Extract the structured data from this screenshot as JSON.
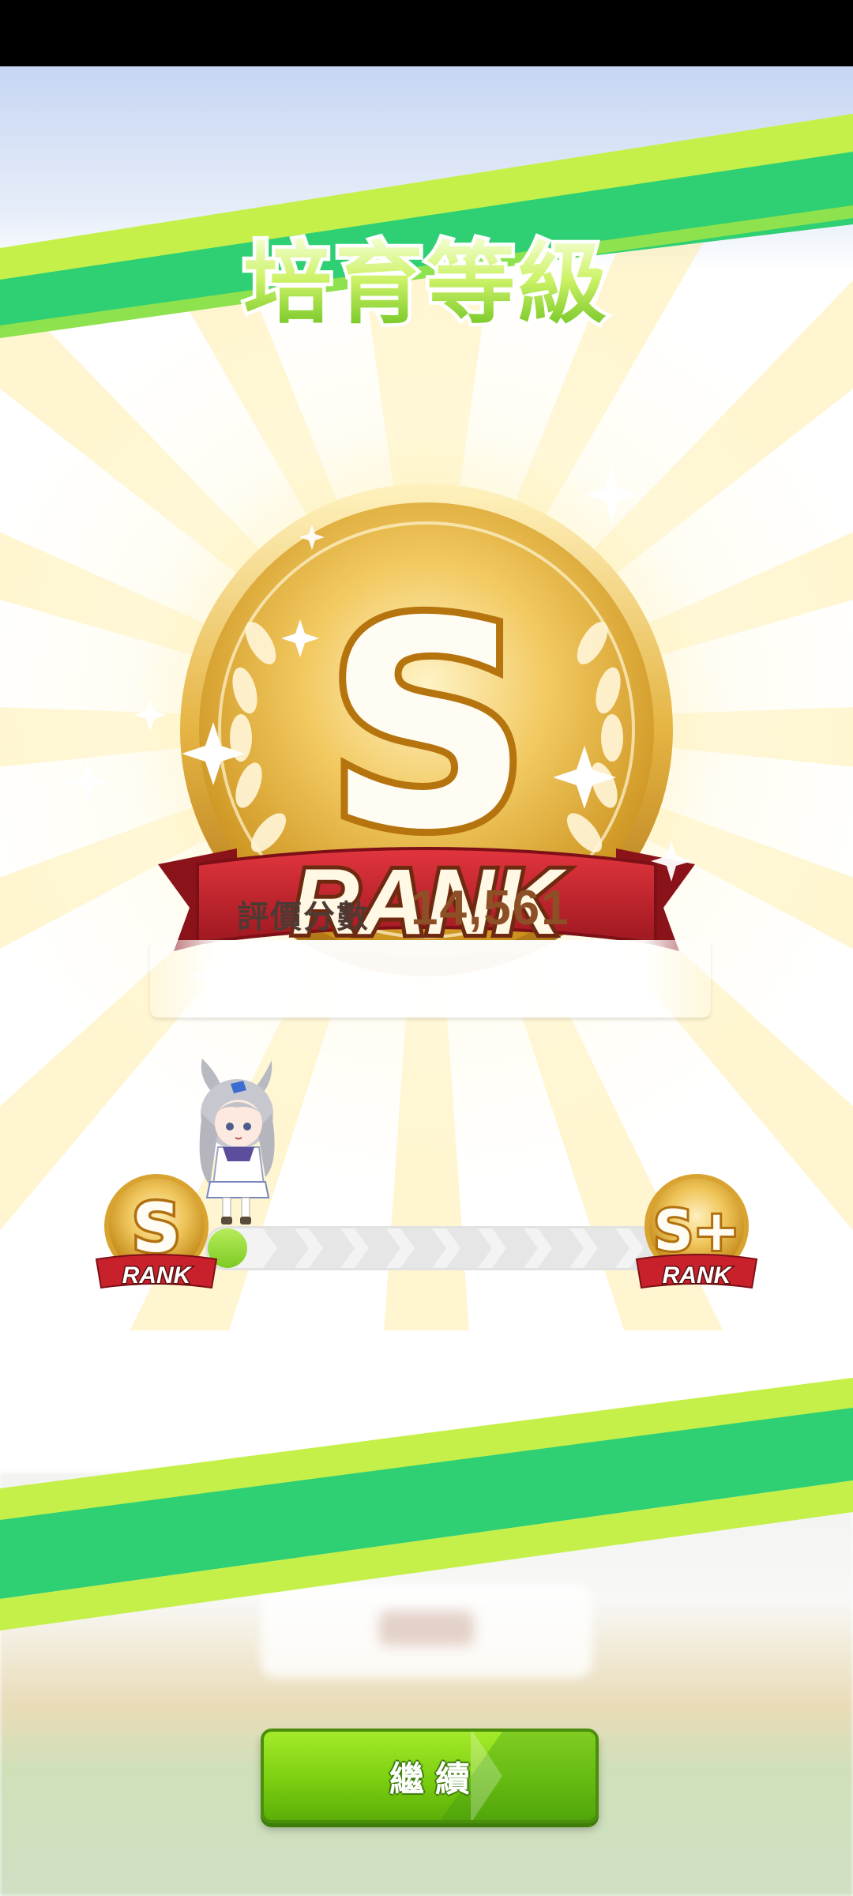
{
  "title": "培育等級",
  "rank": {
    "letter": "S",
    "label": "RANK"
  },
  "score": {
    "label": "評價分數",
    "value": "14,561"
  },
  "progress": {
    "current_rank": {
      "letter": "S",
      "label": "RANK"
    },
    "next_rank": {
      "letter": "S+",
      "label": "RANK"
    },
    "fraction": 0.06
  },
  "continue_button": {
    "label": "繼續"
  },
  "colors": {
    "accent_green": "#2fcf74",
    "lime": "#c5f04a",
    "gold": "#e8b53a",
    "ribbon_red": "#c8212b",
    "score_brown": "#8d5026"
  },
  "icons": [
    "sparkle-icon",
    "laurel-icon",
    "horse-girl-chibi"
  ]
}
